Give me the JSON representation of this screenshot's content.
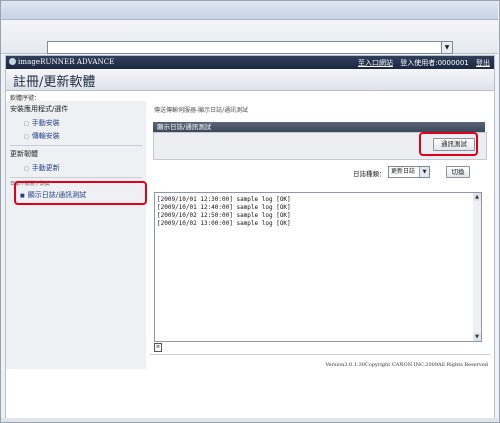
{
  "browser": {
    "address_value": ""
  },
  "brand": {
    "name": "imageRUNNER ADVANCE"
  },
  "top_links": {
    "portal": "至入口網站",
    "login_user": "登入使用者:0000001",
    "logout": "登出"
  },
  "app": {
    "title": "註冊/更新軟體"
  },
  "breadcrumb": "軟體序號：",
  "sidebar": {
    "sections": [
      {
        "header": "安裝應用程式/選件",
        "items": [
          "手動安裝",
          "傳輸安裝"
        ]
      },
      {
        "header": "更新韌體",
        "items": [
          "手動更新"
        ]
      },
      {
        "header": "日誌 / 狀態 / 測試",
        "items": [
          "顯示日誌/通訊測試"
        ]
      }
    ],
    "selected": "顯示日誌/通訊測試"
  },
  "main": {
    "breadcrumb": "傳送傳輸伺服器-顯示日誌/通訊測試",
    "panel_title": "顯示日誌/通訊測試",
    "test_button": "通訊測試",
    "filter_label": "日誌種類：",
    "filter_value": "更新日誌",
    "switch_button": "切換",
    "log_lines": [
      "[2009/10/01 12:30:00] sample log [OK]",
      "[2009/10/01 12:40:00] sample log [OK]",
      "[2009/10/02 12:50:00] sample log [OK]",
      "[2009/10/02 13:00:00] sample log [OK]"
    ]
  },
  "footer": "Version3.0.1.30Copyright CANON INC.2009All Rights Reserved",
  "colors": {
    "highlight": "#e0001a",
    "header_dark": "#1b2740",
    "link": "#1f3f8a"
  }
}
